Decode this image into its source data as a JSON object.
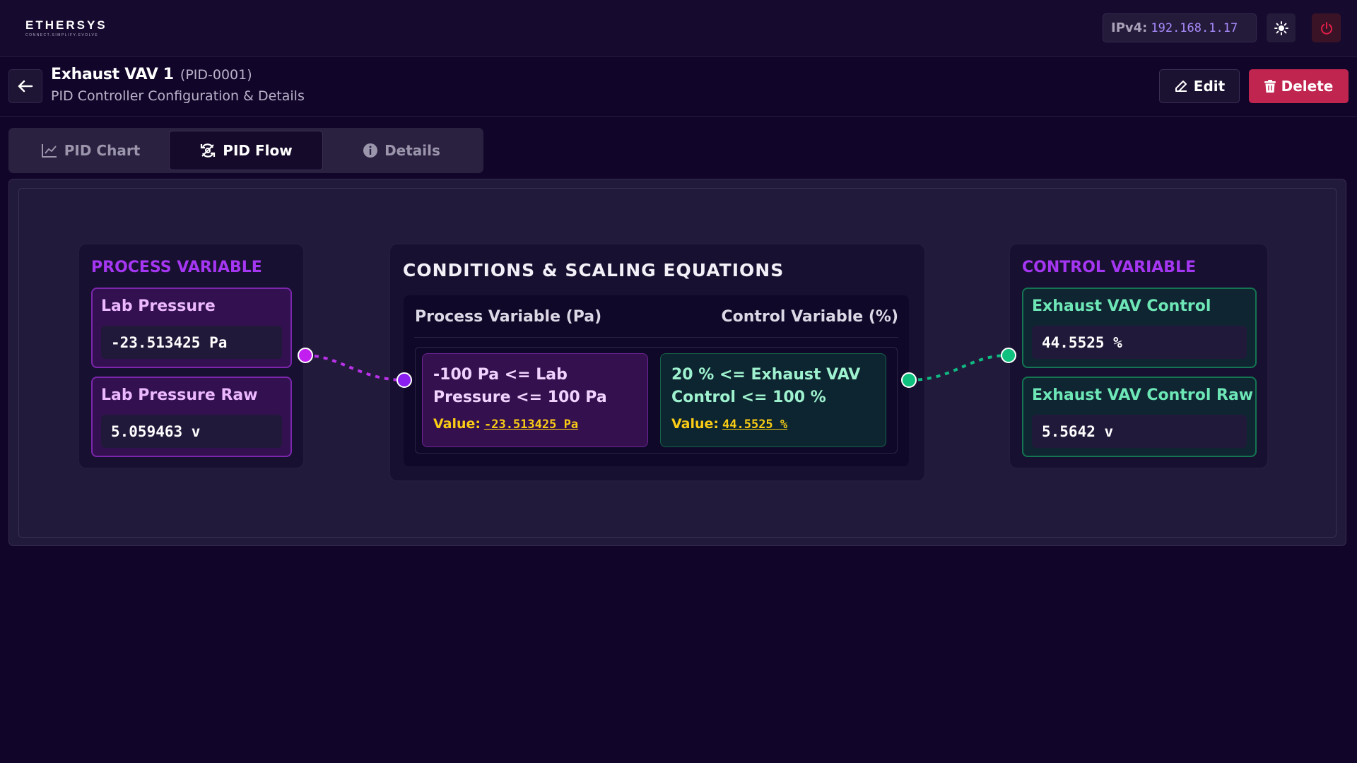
{
  "app": {
    "logo_text": "ETHERSYS",
    "logo_tagline": "CONNECT.SIMPLIFY.EVOLVE"
  },
  "topbar": {
    "ip_label": "IPv4:",
    "ip_value": "192.168.1.17",
    "theme_icon": "sun-icon",
    "power_icon": "power-icon"
  },
  "header": {
    "back_icon": "arrow-left-icon",
    "title": "Exhaust VAV 1",
    "id": "(PID-0001)",
    "subtitle": "PID Controller Configuration & Details",
    "edit_label": "Edit",
    "delete_label": "Delete"
  },
  "tabs": [
    {
      "label": "PID Chart",
      "icon": "line-chart-icon",
      "active": false
    },
    {
      "label": "PID Flow",
      "icon": "flow-cycle-icon",
      "active": true
    },
    {
      "label": "Details",
      "icon": "info-icon",
      "active": false
    }
  ],
  "process_variable": {
    "title": "PROCESS VARIABLE",
    "items": [
      {
        "label": "Lab Pressure",
        "value": "-23.513425 Pa"
      },
      {
        "label": "Lab Pressure Raw",
        "value": "5.059463 v"
      }
    ]
  },
  "conditions": {
    "title": "CONDITIONS & SCALING EQUATIONS",
    "col_process": "Process Variable (Pa)",
    "col_control": "Control Variable (%)",
    "process_expr": "-100 Pa <= Lab Pressure <= 100 Pa",
    "process_value_label": "Value:",
    "process_value": "-23.513425 Pa",
    "control_expr": "20 % <= Exhaust VAV Control <= 100 %",
    "control_value_label": "Value:",
    "control_value": "44.5525 %"
  },
  "control_variable": {
    "title": "CONTROL VARIABLE",
    "items": [
      {
        "label": "Exhaust VAV Control",
        "value": "44.5525 %"
      },
      {
        "label": "Exhaust VAV Control Raw",
        "value": "5.5642 v"
      }
    ]
  },
  "colors": {
    "accent_purple": "#a536f2",
    "accent_green": "#10b981",
    "delete_red": "#c0254f",
    "value_yellow": "#facc15",
    "ip_value": "#a78bfa"
  }
}
